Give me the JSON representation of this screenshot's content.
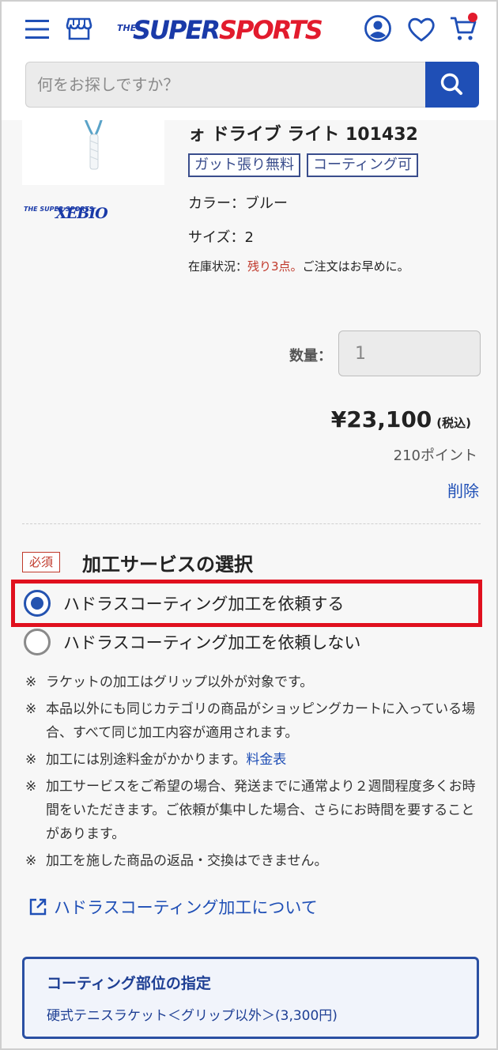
{
  "header": {
    "logo_the": "THE",
    "logo_super": "SUPER",
    "logo_sports": "SPORTS",
    "search_placeholder": "何をお探しですか？",
    "icons": [
      "menu-icon",
      "store-icon",
      "account-icon",
      "heart-icon",
      "cart-icon",
      "search-icon"
    ],
    "colors": {
      "brand_blue": "#1a3aa8",
      "brand_red": "#e21b2d",
      "button_blue": "#1f4fb6"
    }
  },
  "product": {
    "name": "ォ ドライブ ライト 101432",
    "tags": [
      "ガット張り無料",
      "コーティング可"
    ],
    "color": "カラー：ブルー",
    "size": "サイズ：2",
    "stock_label": "在庫状況：",
    "stock_value": "残り3点。",
    "stock_note": "ご注文はお早めに。",
    "brand_logo_small": "THE SUPER SPORTS",
    "brand_logo_xebio": "XEBIO",
    "qty_label": "数量：",
    "qty_value": "1",
    "price": "¥23,100",
    "tax": "(税込)",
    "points": "210ポイント",
    "delete": "削除"
  },
  "service": {
    "required": "必須",
    "title": "加工サービスの選択",
    "options": [
      {
        "label": "ハドラスコーティング加工を依頼する",
        "selected": true
      },
      {
        "label": "ハドラスコーティング加工を依頼しない",
        "selected": false
      }
    ],
    "note_mark": "※",
    "notes": [
      "ラケットの加工はグリップ以外が対象です。",
      "本品以外にも同じカテゴリの商品がショッピングカートに入っている場合、すべて同じ加工内容が適用されます。",
      "加工には別途料金がかかります。",
      "加工サービスをご希望の場合、発送までに通常より２週間程度多くお時間をいただきます。ご依頼が集中した場合、さらにお時間を要することがあります。",
      "加工を施した商品の返品・交換はできません。"
    ],
    "price_table_link": "料金表",
    "about_link": "ハドラスコーティング加工について",
    "coating_box": {
      "title": "コーティング部位の指定",
      "desc": "硬式テニスラケット＜グリップ以外＞(3,300円)"
    }
  }
}
